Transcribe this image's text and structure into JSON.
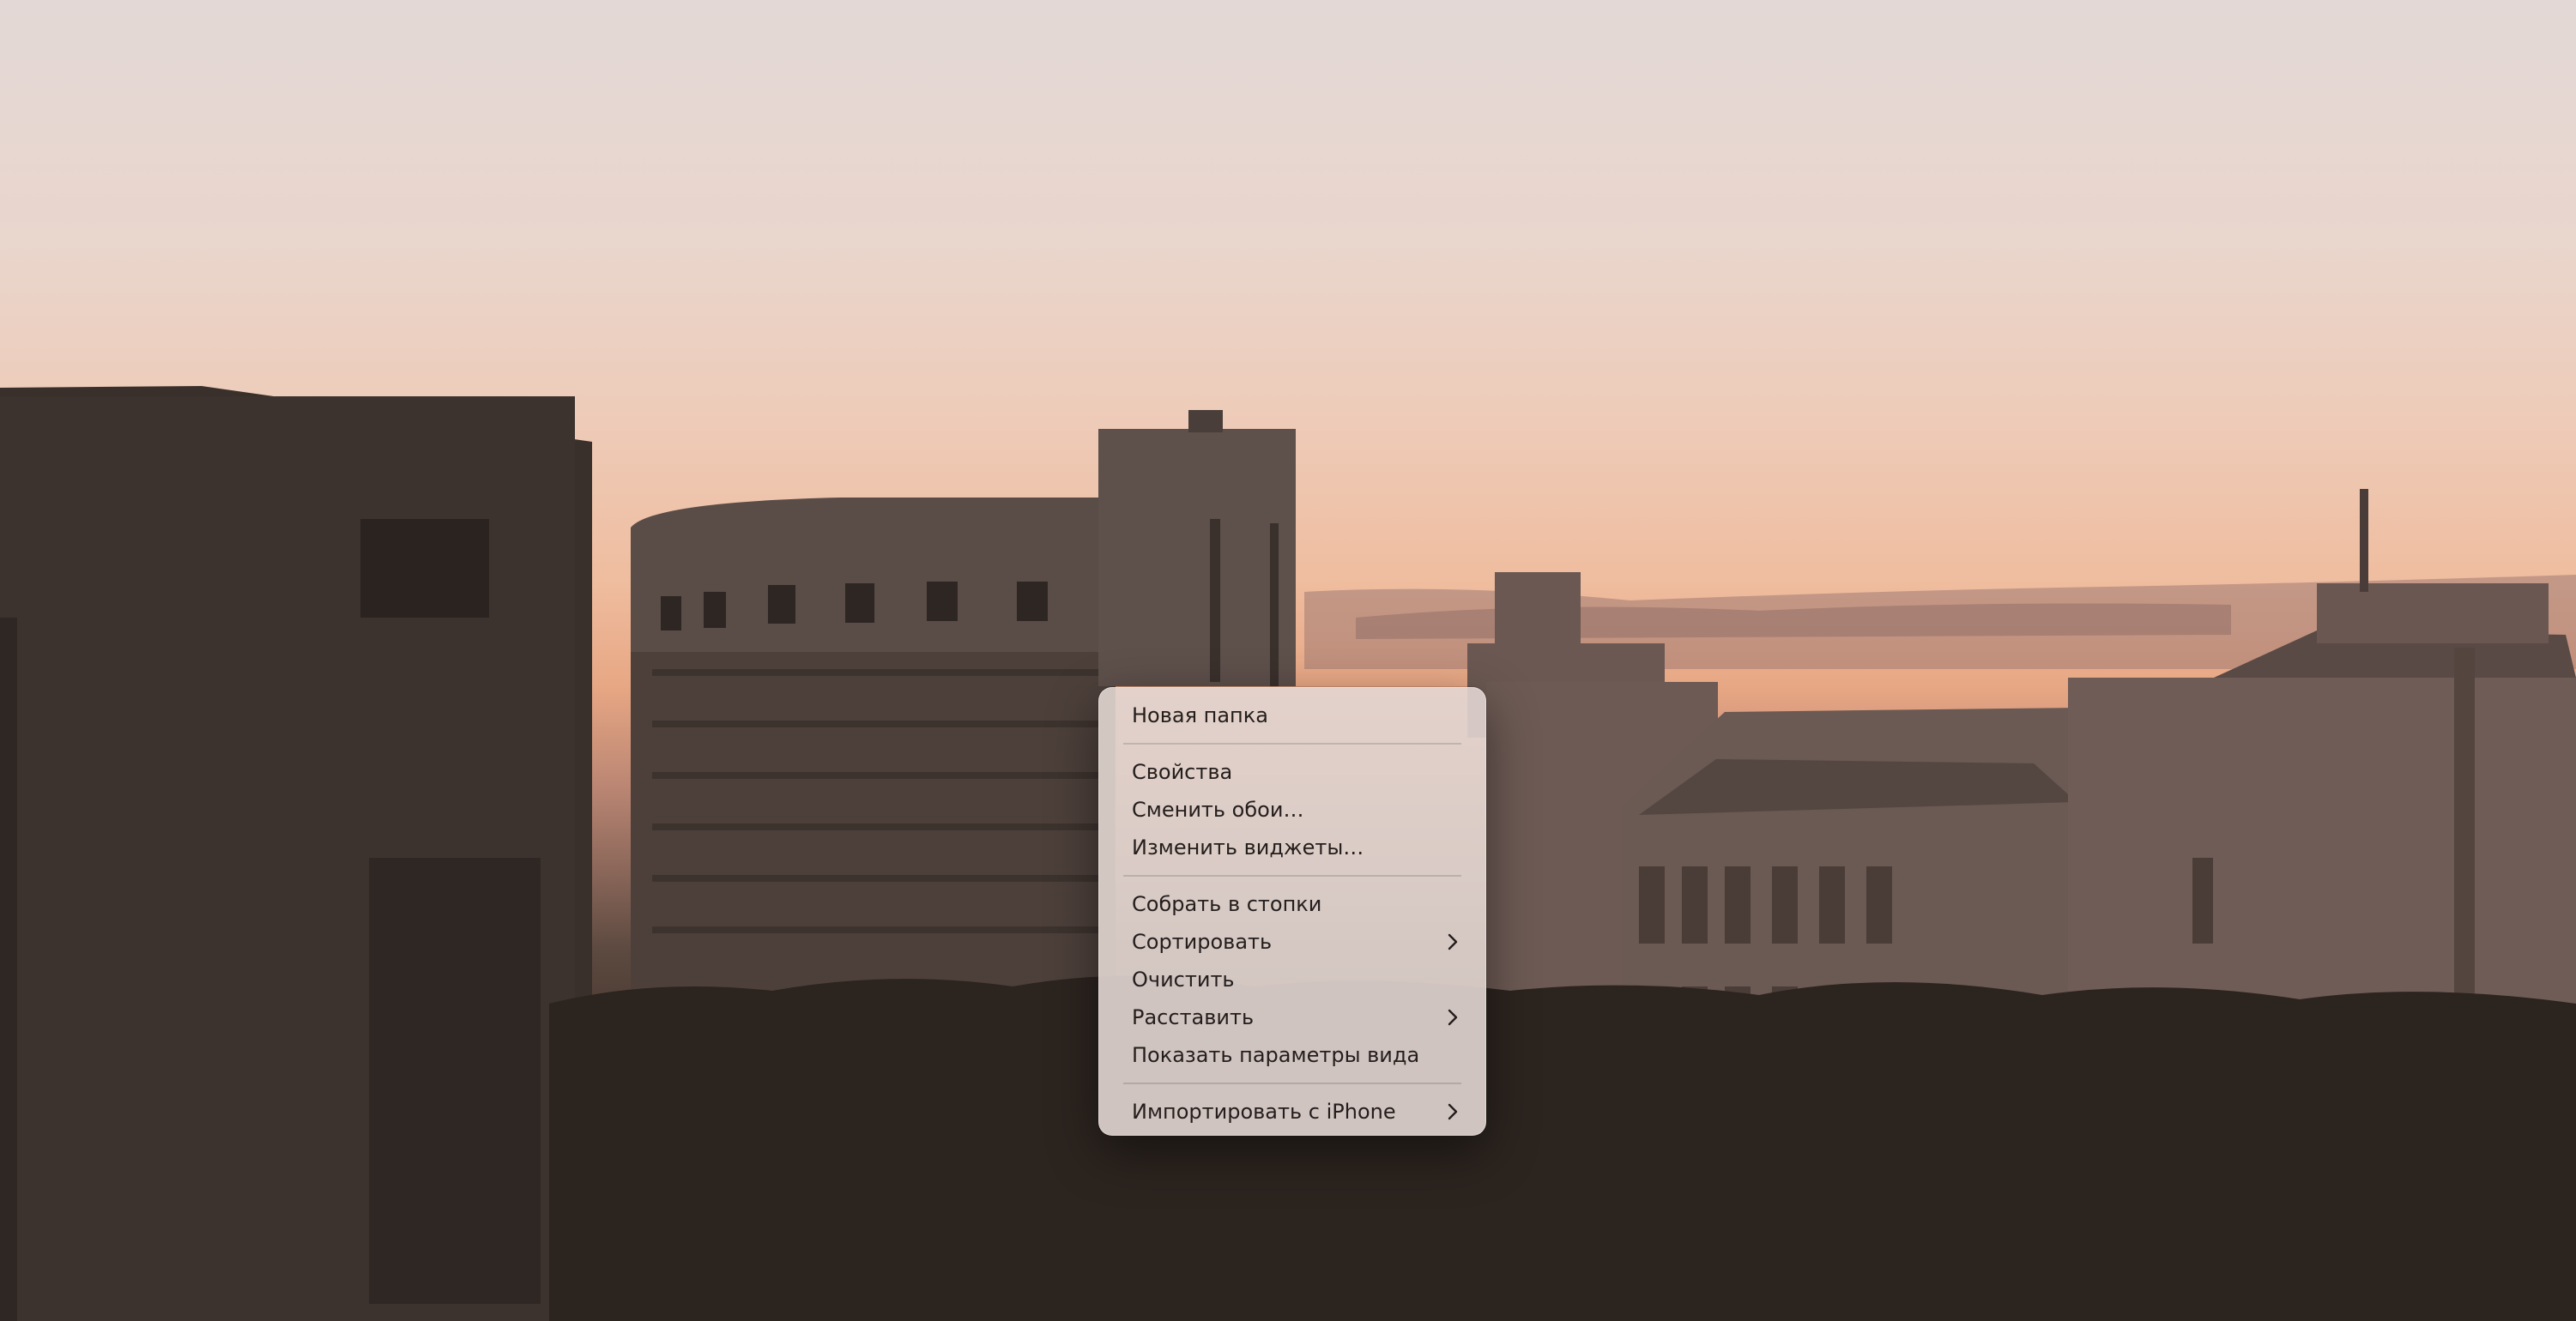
{
  "desktop": {
    "wallpaper": "sunset-city-silhouette"
  },
  "context_menu": {
    "new_folder": "Новая папка",
    "properties": "Свойства",
    "change_wallpaper": "Сменить обои…",
    "edit_widgets": "Изменить виджеты…",
    "use_stacks": "Собрать в стопки",
    "sort_by": "Сортировать",
    "clean_up": "Очистить",
    "clean_up_by": "Расставить",
    "show_view_options": "Показать параметры вида",
    "import_from_iphone": "Импортировать с iPhone"
  },
  "icons": {
    "submenu": "chevron-right-icon"
  },
  "colors": {
    "menu_text": "#241e1c",
    "menu_background": "#e2d6d2",
    "highlight": "#3b78e7"
  }
}
